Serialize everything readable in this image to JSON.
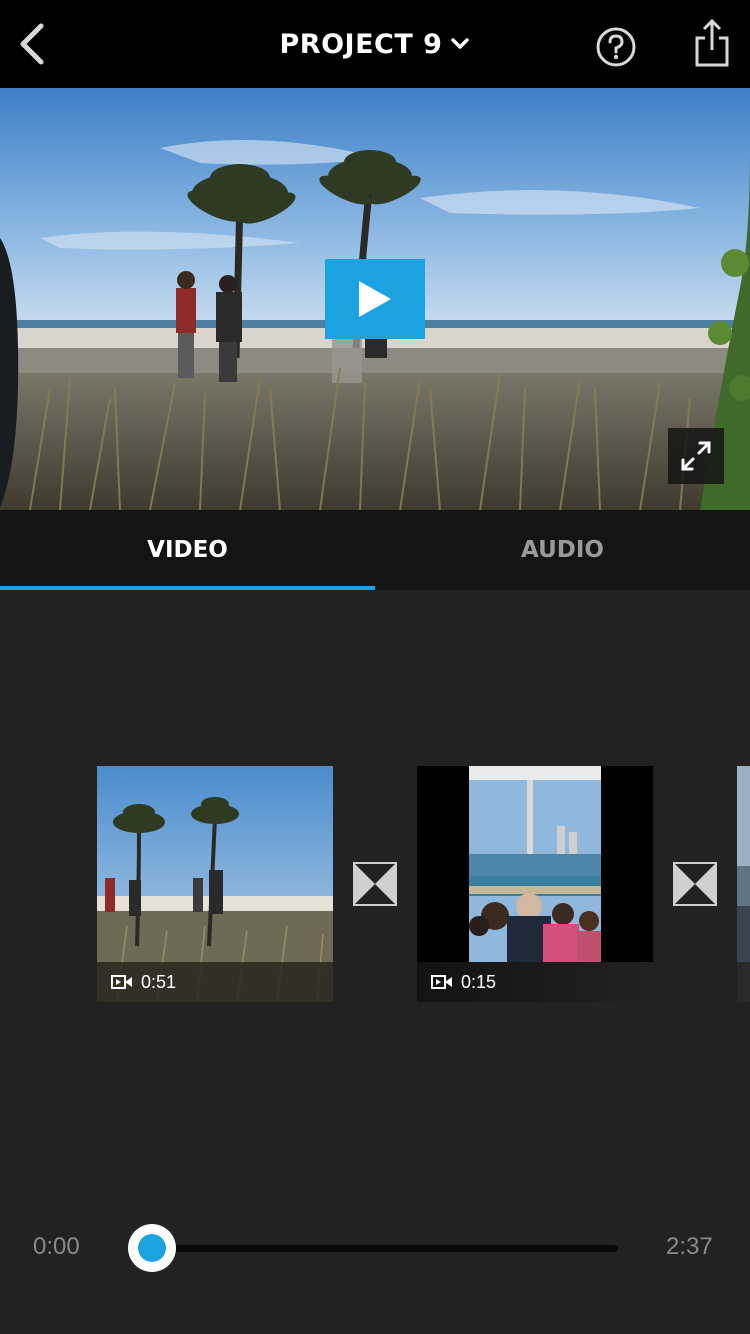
{
  "header": {
    "title": "PROJECT 9",
    "back_icon": "chevron-left-icon",
    "dropdown_icon": "chevron-down-icon",
    "help_icon": "question-circle-icon",
    "share_icon": "share-icon"
  },
  "preview": {
    "play_icon": "play-icon",
    "fullscreen_icon": "expand-icon"
  },
  "tabs": [
    {
      "label": "VIDEO",
      "active": true
    },
    {
      "label": "AUDIO",
      "active": false
    }
  ],
  "clips": [
    {
      "duration": "0:51",
      "icon": "video-camera-icon"
    },
    {
      "duration": "0:15",
      "icon": "video-camera-icon"
    }
  ],
  "scrubber": {
    "start": "0:00",
    "end": "2:37",
    "progress": 0
  },
  "colors": {
    "accent": "#1aa3e0",
    "background": "#222222",
    "header": "#000000"
  }
}
